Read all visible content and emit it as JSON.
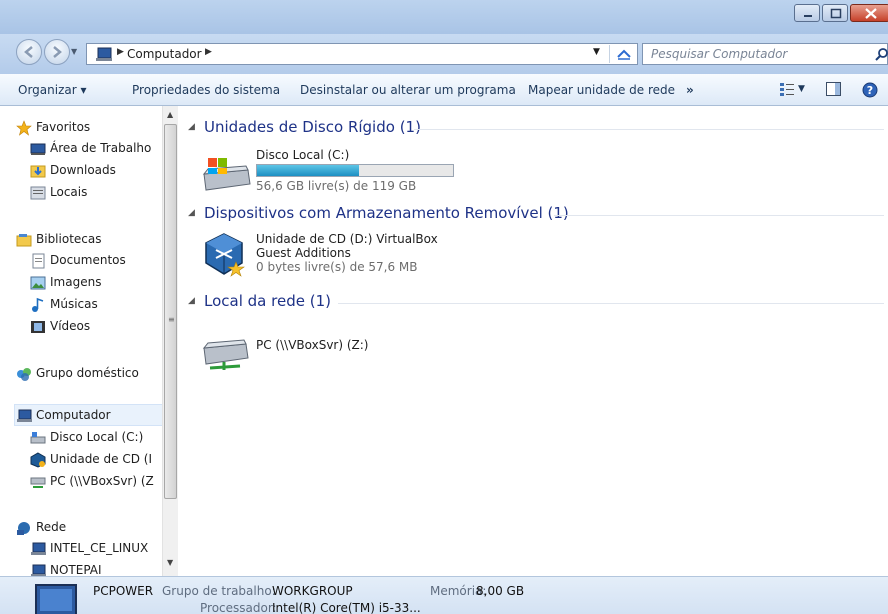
{
  "address_bar": {
    "breadcrumb": "Computador",
    "search_placeholder": "Pesquisar Computador"
  },
  "command_bar": {
    "organize": "Organizar ▾",
    "system_properties": "Propriedades do sistema",
    "uninstall": "Desinstalar ou alterar um programa",
    "map_drive": "Mapear unidade de rede",
    "more": "»"
  },
  "nav": {
    "favorites": "Favoritos",
    "desktop": "Área de Trabalho",
    "downloads": "Downloads",
    "locals": "Locais",
    "libraries": "Bibliotecas",
    "documents": "Documentos",
    "images": "Imagens",
    "music": "Músicas",
    "videos": "Vídeos",
    "homegroup": "Grupo doméstico",
    "computer": "Computador",
    "local_disk": "Disco Local (C:)",
    "cd_drive": "Unidade de CD (I",
    "network_pc": "PC (\\\\VBoxSvr) (Z",
    "network": "Rede",
    "net_intel": "INTEL_CE_LINUX",
    "net_notepai": "NOTEPAI"
  },
  "groups": {
    "hard_disks": {
      "title": "Unidades de Disco Rígido (1)",
      "drive_name": "Disco Local (C:)",
      "drive_free": "56,6 GB livre(s) de 119 GB",
      "used_fraction": 0.52
    },
    "removable": {
      "title": "Dispositivos com Armazenamento Removível (1)",
      "cd_name_line1": "Unidade de CD (D:) VirtualBox",
      "cd_name_line2": "Guest Additions",
      "cd_free": "0 bytes livre(s) de 57,6 MB"
    },
    "network": {
      "title": "Local da rede (1)",
      "share_name": "PC (\\\\VBoxSvr) (Z:)"
    }
  },
  "details": {
    "computer_name": "PCPOWER",
    "workgroup_label": "Grupo de trabalho:",
    "workgroup_value": "WORKGROUP",
    "memory_label": "Memória:",
    "memory_value": "8,00 GB",
    "processor_label": "Processador:",
    "processor_value": "Intel(R) Core(TM) i5-33..."
  },
  "colors": {
    "group_title": "#1e3287",
    "command_text": "#1e395b",
    "drive_bar": "#1c8fc2"
  }
}
